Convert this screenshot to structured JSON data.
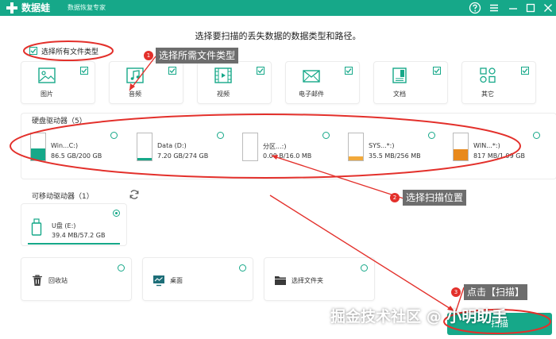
{
  "app": {
    "name": "数据蛙",
    "subtitle": "数据恢复专家"
  },
  "page_title": "选择要扫描的丢失数据的数据类型和路径。",
  "select_all": {
    "label": "选择所有文件类型",
    "checked": true
  },
  "file_types": [
    {
      "label": "图片",
      "icon": "image-icon",
      "checked": true
    },
    {
      "label": "音频",
      "icon": "music-icon",
      "checked": true
    },
    {
      "label": "视频",
      "icon": "video-icon",
      "checked": true
    },
    {
      "label": "电子邮件",
      "icon": "mail-icon",
      "checked": true
    },
    {
      "label": "文档",
      "icon": "document-icon",
      "checked": true
    },
    {
      "label": "其它",
      "icon": "other-icon",
      "checked": true
    }
  ],
  "hard_drives": {
    "title": "硬盘驱动器（5）",
    "items": [
      {
        "name": "Win...C:)",
        "size": "86.5 GB/200 GB",
        "used_fraction": 0.43,
        "color": "#16a889"
      },
      {
        "name": "Data (D:)",
        "size": "7.20 GB/274 GB",
        "used_fraction": 0.03,
        "color": "#16a889"
      },
      {
        "name": "分区...:)",
        "size": "0.00  B/16.0 MB",
        "used_fraction": 0.0,
        "color": "#f2a93b"
      },
      {
        "name": "SYS...*:)",
        "size": "35.5 MB/256 MB",
        "used_fraction": 0.14,
        "color": "#f2a93b"
      },
      {
        "name": "WIN...*:)",
        "size": "817 MB/1.99 GB",
        "used_fraction": 0.41,
        "color": "#e8891c"
      }
    ]
  },
  "removable_drives": {
    "title": "可移动驱动器（1）",
    "items": [
      {
        "name": "U盘 (E:)",
        "size": "39.4 MB/57.2 GB",
        "selected": true
      }
    ]
  },
  "locations": [
    {
      "label": "回收站",
      "icon": "recycle-bin-icon"
    },
    {
      "label": "桌面",
      "icon": "desktop-icon"
    },
    {
      "label": "选择文件夹",
      "icon": "folder-icon"
    }
  ],
  "annotations": [
    {
      "badge": "1",
      "text": "选择所需文件类型"
    },
    {
      "badge": "2",
      "text": "选择扫描位置"
    },
    {
      "badge": "3",
      "text": "点击【扫描】"
    }
  ],
  "scan_button": {
    "label": "扫描"
  },
  "watermark": "掘金技术社区 @ 小明助手",
  "colors": {
    "brand": "#16a889",
    "annotation_red": "#e3302b",
    "callout_gray": "#6d6d6d"
  }
}
